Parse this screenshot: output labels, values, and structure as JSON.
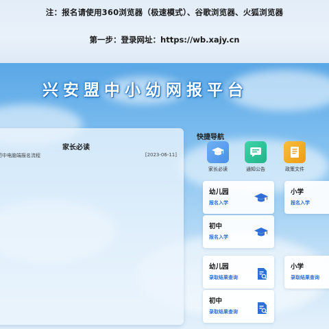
{
  "header": {
    "note": "注：报名请使用360浏览器（极速模式）、谷歌浏览器、火狐浏览器",
    "step": "第一步：登录网址：https://wb.xajy.cn"
  },
  "banner": {
    "title": "兴安盟中小幼网报平台"
  },
  "notice": {
    "title": "家长必读",
    "items": [
      {
        "text": "初中电脑端报名流程",
        "date": "[2023-06-11]"
      }
    ]
  },
  "quick_nav": {
    "label": "快捷导航",
    "items": [
      {
        "label": "家长必读",
        "icon": "graduation-cap-icon",
        "color": "#5aa0ee"
      },
      {
        "label": "通知公告",
        "icon": "chat-bubble-icon",
        "color": "#2fc49a"
      },
      {
        "label": "政策文件",
        "icon": "folder-icon",
        "color": "#f3a621"
      }
    ]
  },
  "cards": [
    {
      "title": "幼儿园",
      "link": "报名入学",
      "icon": "graduation-cap-icon"
    },
    {
      "title": "小学",
      "link": "报名入学",
      "icon": "graduation-cap-icon"
    },
    {
      "title": "初中",
      "link": "报名入学",
      "icon": "graduation-cap-icon"
    },
    {
      "title": "幼儿园",
      "link": "录取结果查询",
      "icon": "document-search-icon"
    },
    {
      "title": "小学",
      "link": "录取结果查询",
      "icon": "document-search-icon"
    },
    {
      "title": "初中",
      "link": "录取结果查询",
      "icon": "document-search-icon"
    }
  ],
  "colors": {
    "accent": "#2f6fd6",
    "sky": "#5aa7e6"
  }
}
